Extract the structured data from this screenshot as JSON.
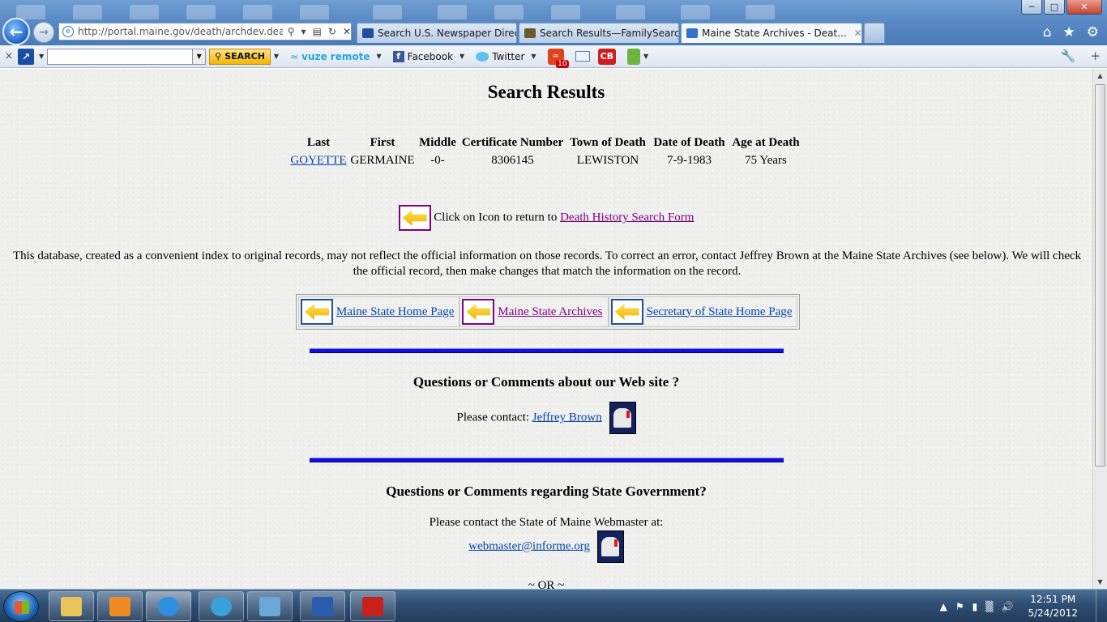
{
  "browser": {
    "url": "http://portal.maine.gov/death/archdev.death_ar",
    "tabs": [
      {
        "label": "Search U.S. Newspaper Directo...",
        "active": false,
        "icon_color": "#1f4e9a"
      },
      {
        "label": "Search Results—FamilySearch....",
        "active": false,
        "icon_color": "#6b5a2a"
      },
      {
        "label": "Maine State Archives - Deat...",
        "active": true,
        "icon_color": "#2f6fcf"
      }
    ],
    "tab_close_glyph": "✕",
    "window_buttons": {
      "minimize": "─",
      "maximize": "□",
      "close": "✕"
    },
    "right_icons": [
      "home-icon",
      "favorites-star-icon",
      "tools-gear-icon"
    ]
  },
  "toolbar": {
    "close_glyph": "×",
    "search_label": "SEARCH",
    "vuze_label": "vuze remote",
    "facebook_label": "Facebook",
    "twitter_label": "Twitter",
    "rss_badge": "10",
    "cb_label": "CB"
  },
  "page": {
    "title": "Search Results",
    "columns": [
      "Last",
      "First",
      "Middle",
      "Certificate Number",
      "Town of Death",
      "Date of Death",
      "Age at Death"
    ],
    "rows": [
      {
        "last": "GOYETTE",
        "first": "GERMAINE",
        "middle": "-0-",
        "certificate": "8306145",
        "town": "LEWISTON",
        "date": "7-9-1983",
        "age": "75 Years"
      }
    ],
    "return_text": "Click on Icon to return to",
    "return_link": "Death History Search Form",
    "disclaimer": "This database, created as a convenient index to original records, may not reflect the official information on those records. To correct an error, contact Jeffrey Brown at the Maine State Archives (see below). We will check the official record, then make changes that match the information on the record.",
    "nav_links": [
      "Maine State Home Page",
      "Maine State Archives",
      "Secretary of State Home Page"
    ],
    "questions_web_title": "Questions or Comments about our Web site ?",
    "please_contact": "Please contact:",
    "contact_name": "Jeffrey Brown",
    "questions_gov_title": "Questions or Comments regarding State Government?",
    "webmaster_text": "Please contact the State of Maine Webmaster at:",
    "webmaster_email": "webmaster@informe.org",
    "or_text": "~ OR ~"
  },
  "taskbar": {
    "apps": [
      "file-explorer",
      "media-player",
      "internet-explorer",
      "app-refresh",
      "photo-viewer",
      "word",
      "acrobat"
    ],
    "time": "12:51 PM",
    "date": "5/24/2012"
  },
  "colors": {
    "link": "#0645ad",
    "visited": "#800080",
    "rule": "#1010d8"
  }
}
